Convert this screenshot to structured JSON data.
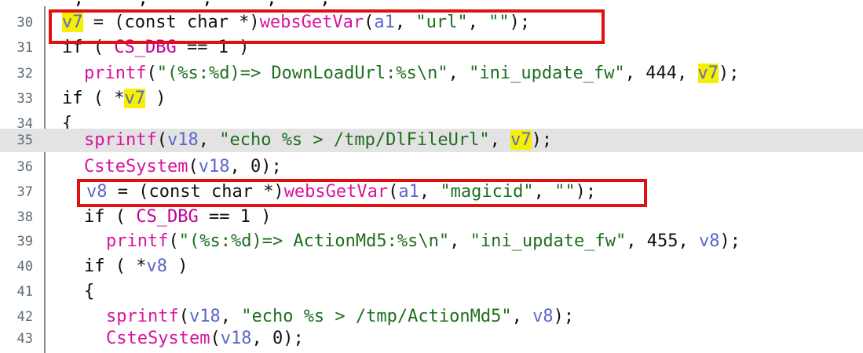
{
  "editor": {
    "top_fragment": "_,_____,_____,_____,____,__",
    "lines": [
      {
        "num": "30"
      },
      {
        "num": "31"
      },
      {
        "num": "32"
      },
      {
        "num": "33"
      },
      {
        "num": "34"
      },
      {
        "num": "35"
      },
      {
        "num": "36"
      },
      {
        "num": "37"
      },
      {
        "num": "38"
      },
      {
        "num": "39"
      },
      {
        "num": "40"
      },
      {
        "num": "41"
      },
      {
        "num": "42"
      },
      {
        "num": "43"
      }
    ]
  },
  "tokens": {
    "v7": "v7",
    "v8": "v8",
    "v18": "v18",
    "a1": "a1",
    "eq": " = ",
    "cast": "(const char *)",
    "websGetVar": "websGetVar",
    "printf": "printf",
    "sprintf": "sprintf",
    "CsteSystem": "CsteSystem",
    "if": "if",
    "CS_DBG": "CS_DBG",
    "str_url": "\"url\"",
    "str_empty": "\"\"",
    "str_magicid": "\"magicid\"",
    "fmt_downloadurl": "\"(%s:%d)=> DownLoadUrl:%s\\n\"",
    "fmt_actionmd5": "\"(%s:%d)=> ActionMd5:%s\\n\"",
    "str_ini_update_fw": "\"ini_update_fw\"",
    "str_echo_dlfileurl": "\"echo %s > /tmp/DlFileUrl\"",
    "str_echo_actionmd5": "\"echo %s > /tmp/ActionMd5\"",
    "num_444": "444",
    "num_455": "455",
    "num_0": "0",
    "num_1": "1",
    "open_brace": "{"
  },
  "colors": {
    "function": "#d8159c",
    "string": "#1e6f1e",
    "variable": "#5b66c9",
    "highlight_yellow": "#f4f000",
    "redbox": "#e11010",
    "current_line": "#e3e3e3"
  }
}
